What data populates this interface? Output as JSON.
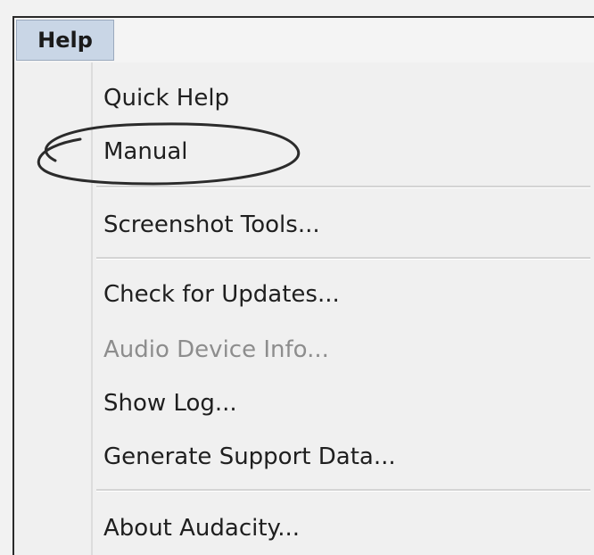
{
  "menubar": {
    "help_label": "Help"
  },
  "help_menu": {
    "items": [
      {
        "label": "Quick Help",
        "enabled": true
      },
      {
        "label": "Manual",
        "enabled": true
      },
      {
        "label": "Screenshot Tools...",
        "enabled": true
      },
      {
        "label": "Check for Updates...",
        "enabled": true
      },
      {
        "label": "Audio Device Info...",
        "enabled": false
      },
      {
        "label": "Show Log...",
        "enabled": true
      },
      {
        "label": "Generate Support Data...",
        "enabled": true
      },
      {
        "label": "About Audacity...",
        "enabled": true
      }
    ]
  },
  "annotation": {
    "circled_item": "Manual",
    "color": "#2b2b2b"
  },
  "colors": {
    "help_highlight": "#c9d6e6",
    "menu_background": "#f0f0f0",
    "disabled_text": "#8d8d8d"
  }
}
